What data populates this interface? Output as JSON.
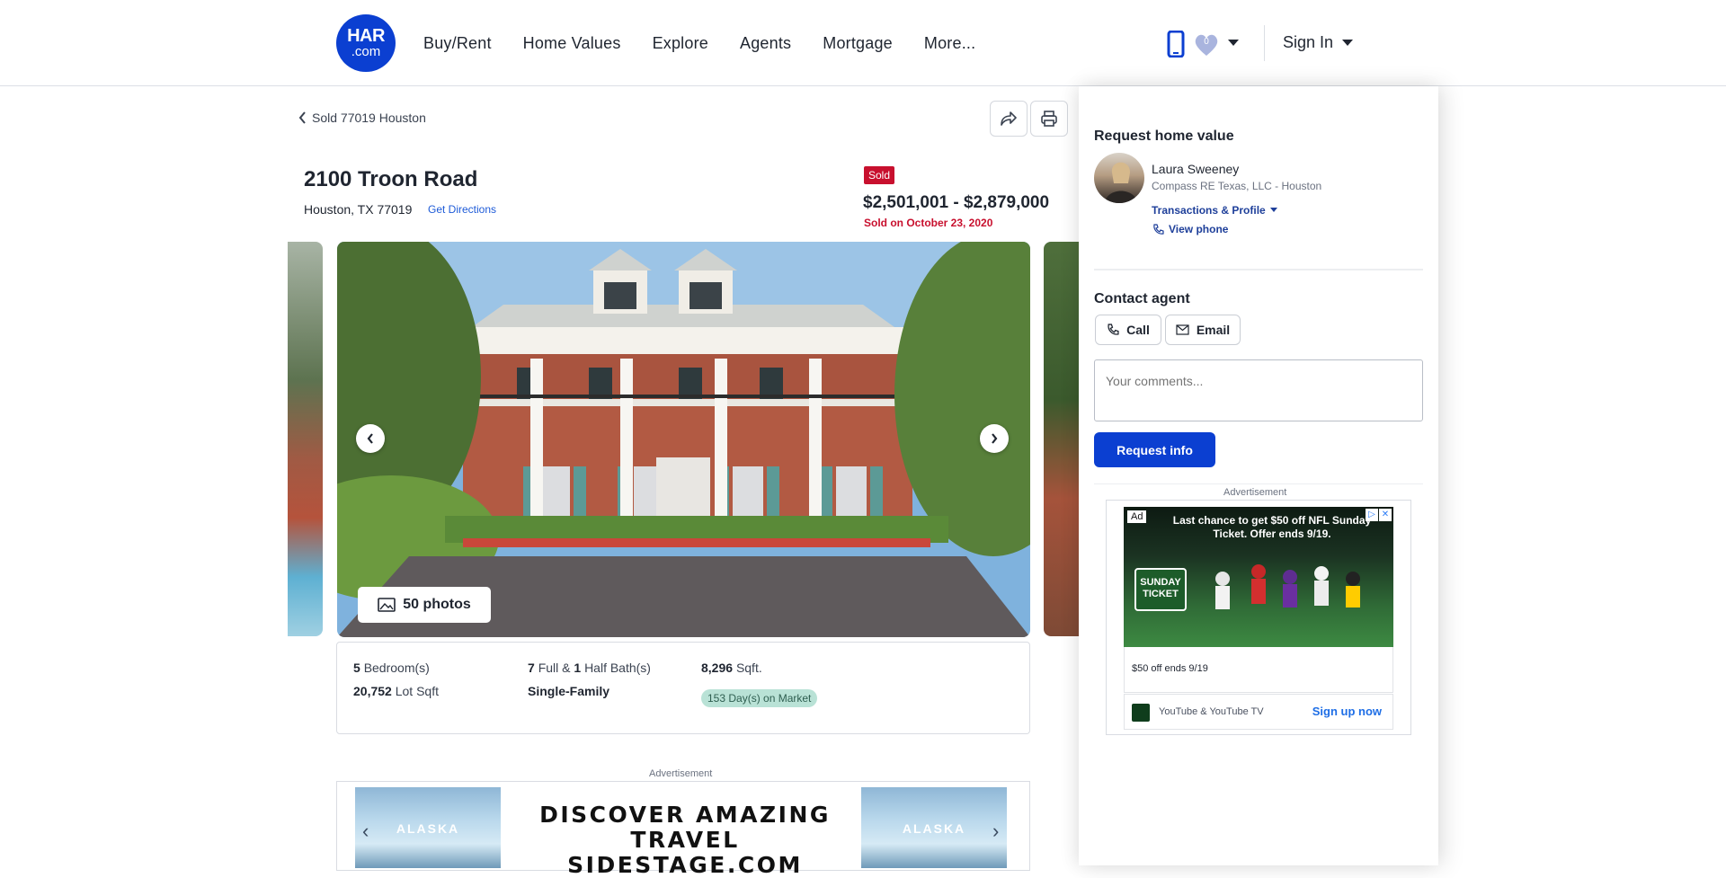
{
  "header": {
    "logo_top": "HAR",
    "logo_bottom": ".com",
    "nav": [
      "Buy/Rent",
      "Home Values",
      "Explore",
      "Agents",
      "Mortgage",
      "More..."
    ],
    "favorites_count": "0",
    "sign_in": "Sign In"
  },
  "breadcrumb": "Sold 77019 Houston",
  "listing": {
    "title": "2100 Troon Road",
    "address": "Houston, TX 77019",
    "directions": "Get Directions",
    "status": "Sold",
    "price": "$2,501,001 - $2,879,000",
    "sold_date": "Sold on October 23, 2020",
    "photos_label": "50 photos"
  },
  "details": {
    "beds_value": "5",
    "beds_label": "Bedroom(s)",
    "full_baths": "7",
    "full_label": "Full &",
    "half_baths": "1",
    "half_label": "Half Bath(s)",
    "sqft_value": "8,296",
    "sqft_label": "Sqft.",
    "lot_value": "20,752",
    "lot_label": "Lot Sqft",
    "type": "Single-Family",
    "days_on_market": "153 Day(s) on Market"
  },
  "banner_ad": {
    "label": "Advertisement",
    "left_tag": "ALASKA",
    "right_tag": "ALASKA",
    "line1": "DISCOVER AMAZING TRAVEL",
    "line2": "SIDESTAGE.COM"
  },
  "panel": {
    "request_heading": "Request home value",
    "agent_name": "Laura Sweeney",
    "agent_company": "Compass RE Texas, LLC - Houston",
    "profile_link": "Transactions & Profile",
    "phone_link": "View phone",
    "contact_heading": "Contact agent",
    "call_label": "Call",
    "email_label": "Email",
    "comments_placeholder": "Your comments...",
    "request_button": "Request info"
  },
  "side_ad": {
    "label": "Advertisement",
    "tag": "Ad",
    "headline": "Last chance to get $50 off NFL Sunday Ticket. Offer ends 9/19.",
    "ticket_logo": "SUNDAY TICKET",
    "caption": "$50 off ends 9/19",
    "advertiser": "YouTube & YouTube TV",
    "cta": "Sign up now"
  },
  "colors": {
    "brand_blue": "#0b3fd1",
    "sold_red": "#c8102e",
    "link_blue": "#1e5bd8"
  }
}
